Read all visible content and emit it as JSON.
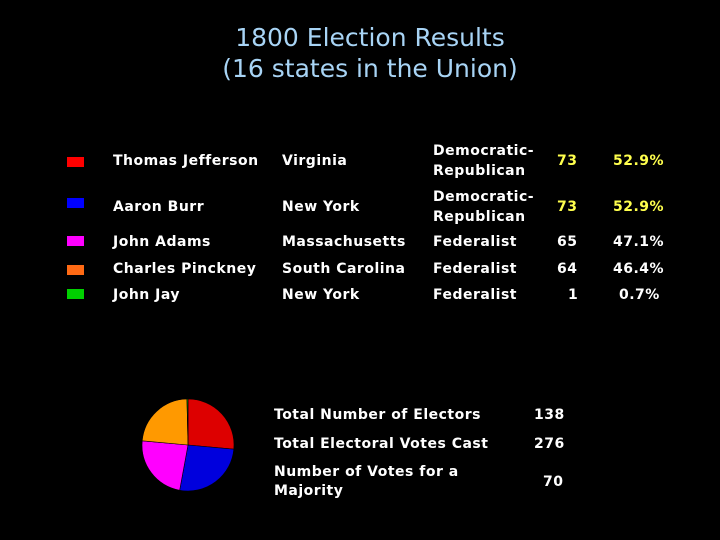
{
  "title": {
    "line1": "1800 Election Results",
    "line2": "(16 states in the Union)"
  },
  "candidates": [
    {
      "name": "Thomas Jefferson",
      "state": "Virginia",
      "party_line1": "Democratic-",
      "party_line2": "Republican",
      "votes": "73",
      "percent": "52.9%",
      "color": "#ff0000",
      "highlight": "#ffff4d"
    },
    {
      "name": "Aaron Burr",
      "state": "New York",
      "party_line1": "Democratic-",
      "party_line2": "Republican",
      "votes": "73",
      "percent": "52.9%",
      "color": "#0000ff",
      "highlight": "#ffff4d"
    },
    {
      "name": "John Adams",
      "state": "Massachusetts",
      "party_line1": "Federalist",
      "party_line2": "",
      "votes": "65",
      "percent": "47.1%",
      "color": "#ff00ff",
      "highlight": "#ffffff"
    },
    {
      "name": "Charles Pinckney",
      "state": "South Carolina",
      "party_line1": "Federalist",
      "party_line2": "",
      "votes": "64",
      "percent": "46.4%",
      "color": "#ff6a14",
      "highlight": "#ffffff"
    },
    {
      "name": "John Jay",
      "state": "New York",
      "party_line1": "Federalist",
      "party_line2": "",
      "votes": "1",
      "percent": "0.7%",
      "color": "#00d000",
      "highlight": "#ffffff"
    }
  ],
  "stats": {
    "electors_label": "Total Number of Electors",
    "electors_value": "138",
    "cast_label": "Total Electoral Votes Cast",
    "cast_value": "276",
    "majority_label_line1": "Number of Votes for a",
    "majority_label_line2": "Majority",
    "majority_value": "70"
  },
  "chart_data": {
    "type": "pie",
    "title": "",
    "categories": [
      "Thomas Jefferson",
      "Aaron Burr",
      "John Adams",
      "Charles Pinckney",
      "John Jay"
    ],
    "values": [
      73,
      73,
      65,
      64,
      1
    ],
    "colors": [
      "#dd0000",
      "#0000dd",
      "#ff00ff",
      "#ff9900",
      "#00d000"
    ],
    "start_angle": "top",
    "direction": "clockwise",
    "legend": "left-table"
  }
}
